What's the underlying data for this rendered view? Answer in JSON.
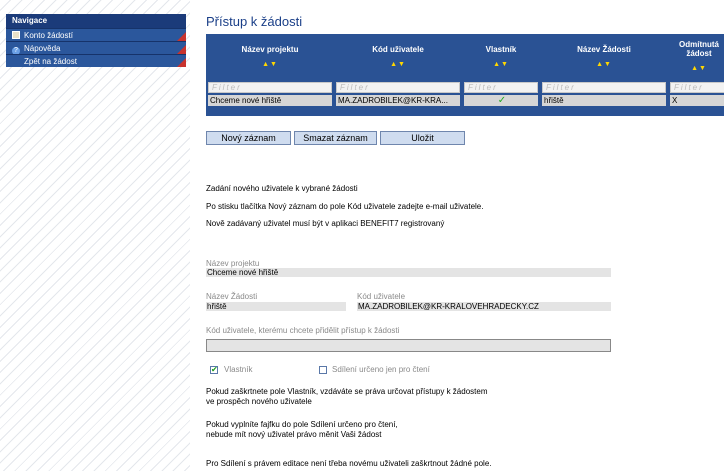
{
  "sidebar": {
    "heading": "Navigace",
    "items": [
      {
        "label": "Konto žádostí",
        "icon": "book-icon"
      },
      {
        "label": "Nápověda",
        "icon": "help-icon"
      },
      {
        "label": "Zpět na žádost",
        "icon": ""
      }
    ]
  },
  "page": {
    "title": "Přístup k žádosti"
  },
  "grid": {
    "columns": [
      "Název projektu",
      "Kód uživatele",
      "Vlastník",
      "Název Žádosti",
      "Odmítnutá žádost"
    ],
    "sort_glyph": "▲▼",
    "filter_placeholder": "Filter",
    "row": {
      "nazev_projektu": "Chceme nové hřiště",
      "kod_uzivatele": "MA.ZADROBILEK@KR-KRA...",
      "vlastnik": "✓",
      "nazev_zadosti": "hřiště",
      "odmitnuta": "X"
    }
  },
  "buttons": {
    "new": "Nový záznam",
    "delete": "Smazat záznam",
    "save": "Uložit"
  },
  "instructions": {
    "line1": "Zadání nového uživatele k vybrané žádosti",
    "line2": "Po stisku tlačítka Nový záznam do pole Kód uživatele zadejte e-mail uživatele.",
    "line3": "Nově zadávaný uživatel musí být v aplikaci BENEFIT7 registrovaný"
  },
  "form": {
    "nazev_projektu_label": "Název projektu",
    "nazev_projektu_value": "Chceme nové hřiště",
    "nazev_zadosti_label": "Název Žádosti",
    "nazev_zadosti_value": "hřiště",
    "kod_uzivatele_label": "Kód uživatele",
    "kod_uzivatele_value": "MA.ZADROBILEK@KR-KRALOVEHRADECKY.CZ",
    "pridelit_label": "Kód uživatele, kterému chcete přidělit přístup k žádosti",
    "pridelit_value": "",
    "vlastnik_label": "Vlastník",
    "vlastnik_checked": true,
    "sdileni_label": "Sdílení určeno jen pro čtení",
    "sdileni_checked": false
  },
  "notes": {
    "n1a": "Pokud zaškrtnete pole Vlastník, vzdáváte se práva určovat přístupy k žádostem",
    "n1b": "ve prospěch nového uživatele",
    "n2a": "Pokud vyplníte fajfku do pole Sdílení určeno pro čtení,",
    "n2b": "nebude mít nový uživatel právo měnit Vaši žádost",
    "n3": "Pro Sdílení s právem editace není třeba novému uživateli zaškrtnout žádné pole."
  },
  "colors": {
    "nav_header": "#1b3b7a",
    "nav_item": "#2b579c",
    "grid_header": "#2a5294",
    "accent_red": "#c8332e",
    "title": "#1a3f88"
  }
}
